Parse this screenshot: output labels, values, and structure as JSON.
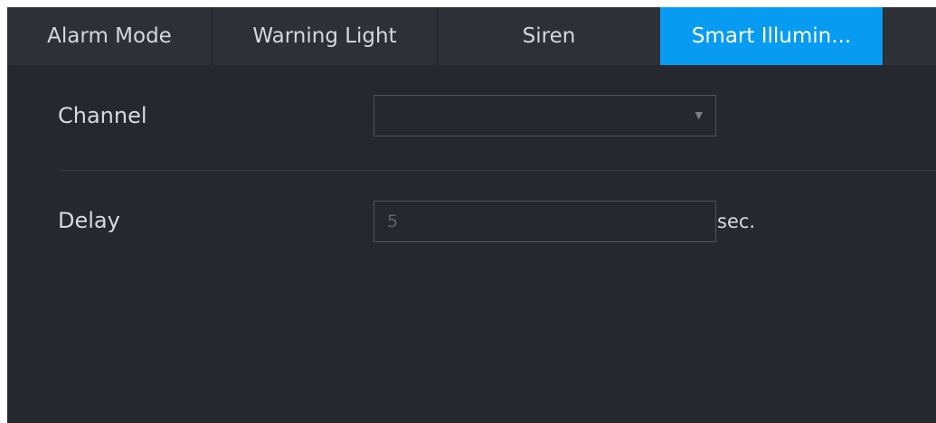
{
  "tabs": [
    {
      "label": "Alarm Mode",
      "active": false
    },
    {
      "label": "Warning Light",
      "active": false
    },
    {
      "label": "Siren",
      "active": false
    },
    {
      "label": "Smart Illumin...",
      "active": true
    }
  ],
  "form": {
    "channel": {
      "label": "Channel",
      "value": "",
      "icon": "caret-down-icon",
      "caret_glyph": "▼"
    },
    "delay": {
      "label": "Delay",
      "value": "5",
      "unit": "sec."
    }
  },
  "colors": {
    "background": "#262830",
    "tab_bar": "#2e3038",
    "active_tab": "#079bf2",
    "text": "#d8dadf",
    "field_border": "#4f5260"
  }
}
